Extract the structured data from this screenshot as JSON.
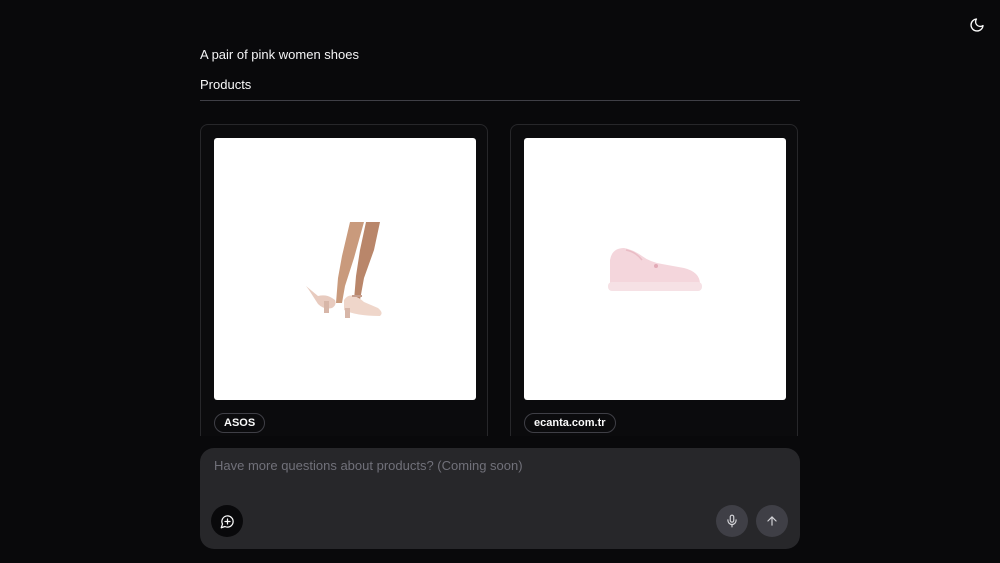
{
  "header": {
    "theme_toggle_icon": "moon-icon"
  },
  "query": {
    "text": "A pair of pink women shoes"
  },
  "products_section": {
    "title": "Products",
    "items": [
      {
        "image_icon": "pink-heels-image",
        "source": "ASOS"
      },
      {
        "image_icon": "pink-sneaker-image",
        "source": "ecanta.com.tr"
      }
    ]
  },
  "composer": {
    "placeholder": "Have more questions about products? (Coming soon)",
    "value": "",
    "new_chat_icon": "message-plus-icon",
    "mic_icon": "microphone-icon",
    "send_icon": "arrow-up-icon"
  },
  "colors": {
    "background": "#09090b",
    "composer": "#27272a",
    "border": "#27272a",
    "text": "#fafafa",
    "muted": "#71717a"
  }
}
